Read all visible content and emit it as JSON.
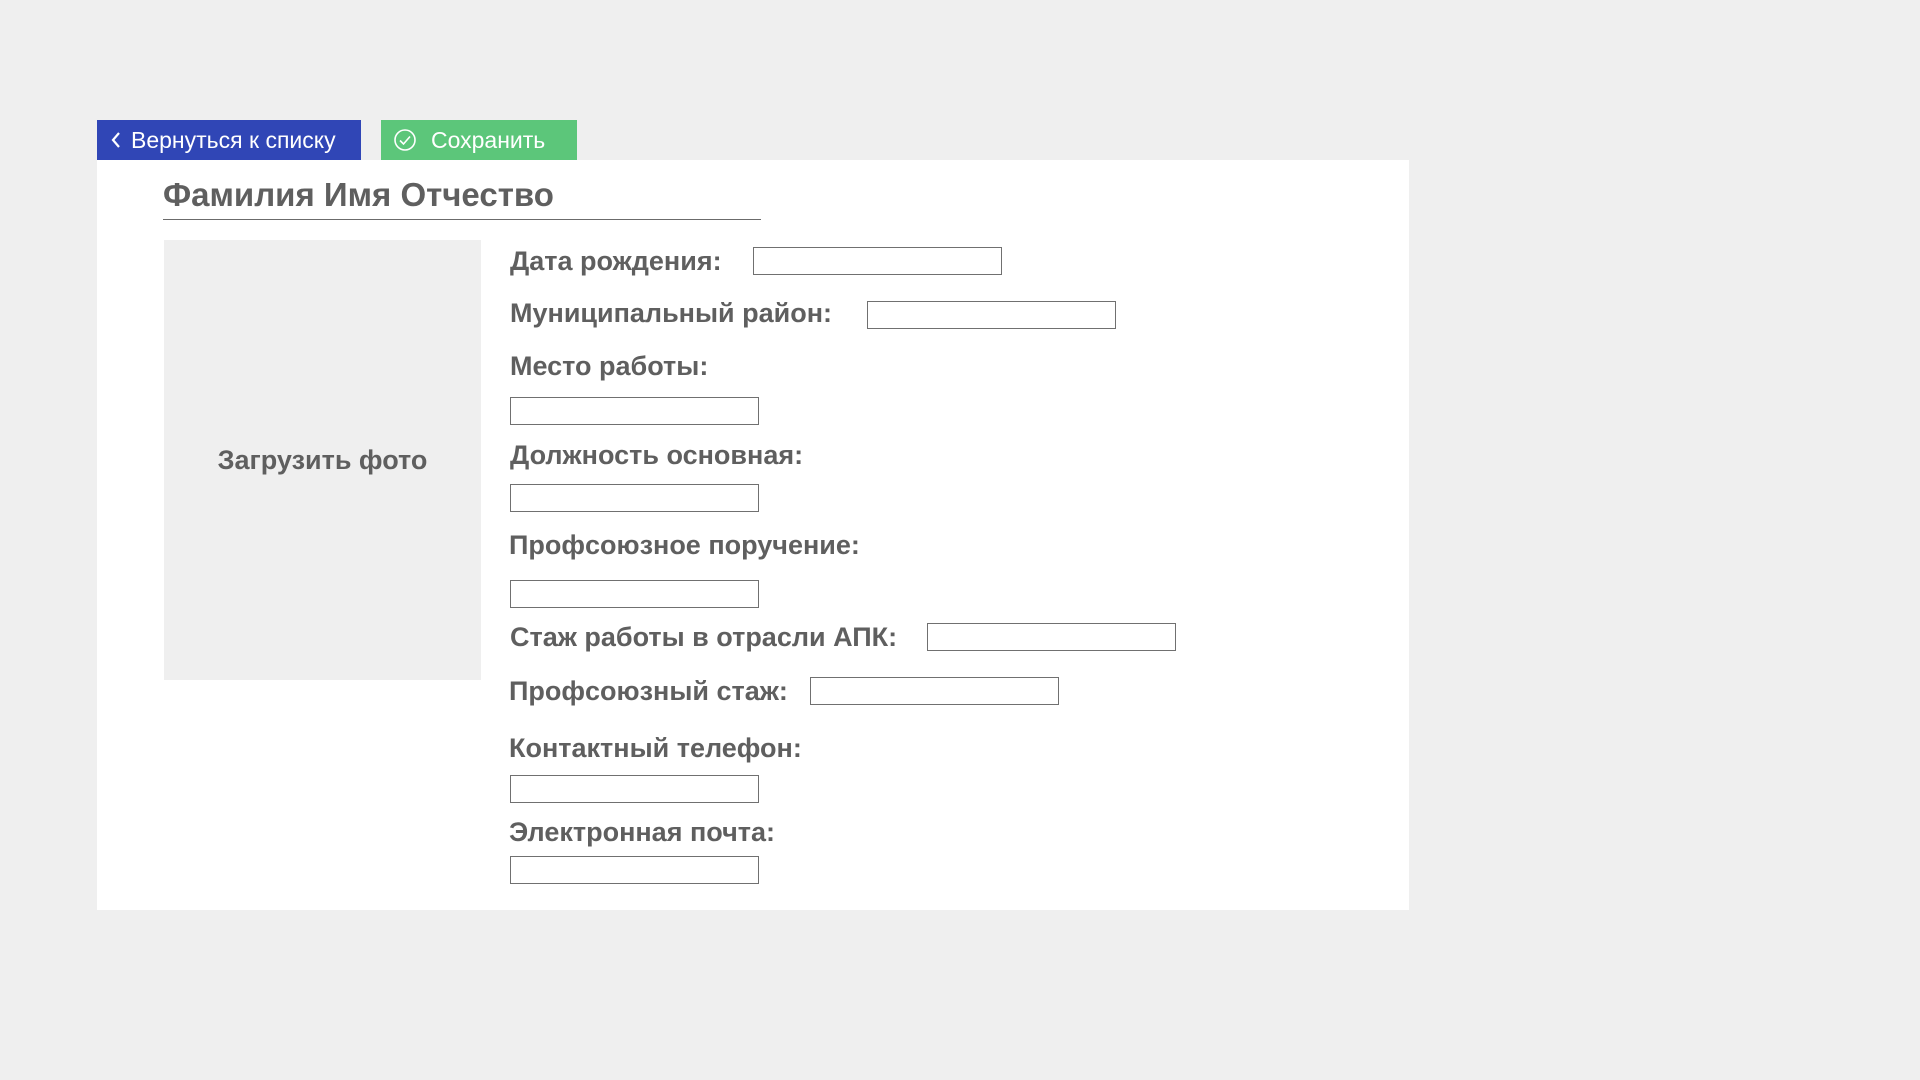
{
  "toolbar": {
    "back_label": "Вернуться к списку",
    "save_label": "Сохранить",
    "back_color": "#3046b6",
    "save_color": "#5cc67a"
  },
  "profile": {
    "full_name": "Фамилия Имя Отчество",
    "upload_photo_label": "Загрузить фото"
  },
  "fields": {
    "birth_date": {
      "label": "Дата рождения:",
      "value": ""
    },
    "district": {
      "label": "Муниципальный район:",
      "value": ""
    },
    "workplace": {
      "label": "Место работы:",
      "value": ""
    },
    "position": {
      "label": "Должность основная:",
      "value": ""
    },
    "union_duty": {
      "label": "Профсоюзное поручение:",
      "value": ""
    },
    "apk_experience": {
      "label": "Стаж работы в отрасли АПК:",
      "value": ""
    },
    "union_experience": {
      "label": "Профсоюзный стаж:",
      "value": ""
    },
    "phone": {
      "label": "Контактный телефон:",
      "value": ""
    },
    "email": {
      "label": "Электронная почта:",
      "value": ""
    }
  },
  "icons": {
    "back": "chevron-left-icon",
    "save": "check-circle-icon"
  }
}
